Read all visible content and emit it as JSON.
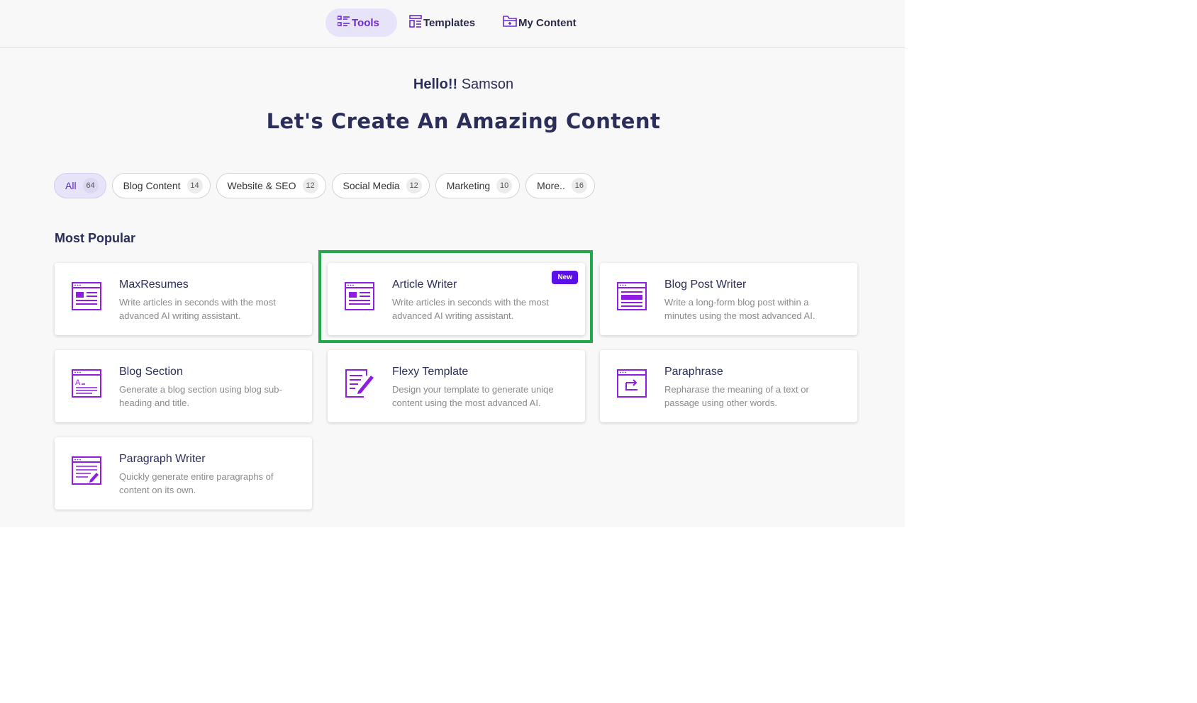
{
  "nav": {
    "tools": "Tools",
    "templates": "Templates",
    "my_content": "My Content"
  },
  "greeting": {
    "hello": "Hello!!",
    "name": "Samson"
  },
  "headline": "Let's Create An Amazing Content",
  "filters": [
    {
      "label": "All",
      "count": "64"
    },
    {
      "label": "Blog Content",
      "count": "14"
    },
    {
      "label": "Website & SEO",
      "count": "12"
    },
    {
      "label": "Social Media",
      "count": "12"
    },
    {
      "label": "Marketing",
      "count": "10"
    },
    {
      "label": "More..",
      "count": "16"
    }
  ],
  "section_title": "Most Popular",
  "cards": [
    {
      "title": "MaxResumes",
      "desc": "Write articles in seconds with the most advanced AI writing assistant.",
      "icon": "article-icon"
    },
    {
      "title": "Article Writer",
      "desc": "Write articles in seconds with the most advanced AI writing assistant.",
      "icon": "article-icon",
      "badge": "New"
    },
    {
      "title": "Blog Post Writer",
      "desc": "Write a long-form blog post within a minutes using the most advanced AI.",
      "icon": "blog-post-icon"
    },
    {
      "title": "Blog Section",
      "desc": "Generate a blog section using blog sub-heading and title.",
      "icon": "blog-section-icon"
    },
    {
      "title": "Flexy Template",
      "desc": "Design your template to generate uniqe content using the most advanced AI.",
      "icon": "edit-document-icon"
    },
    {
      "title": "Paraphrase",
      "desc": "Repharase the meaning of a text or passage using other words.",
      "icon": "paraphrase-icon"
    },
    {
      "title": "Paragraph Writer",
      "desc": "Quickly generate entire paragraphs of content on its own.",
      "icon": "paragraph-icon"
    }
  ],
  "colors": {
    "accent": "#8e1de0",
    "nav_active": "#6a2ad0",
    "highlight": "#23a84b",
    "badge": "#5c10e8"
  }
}
